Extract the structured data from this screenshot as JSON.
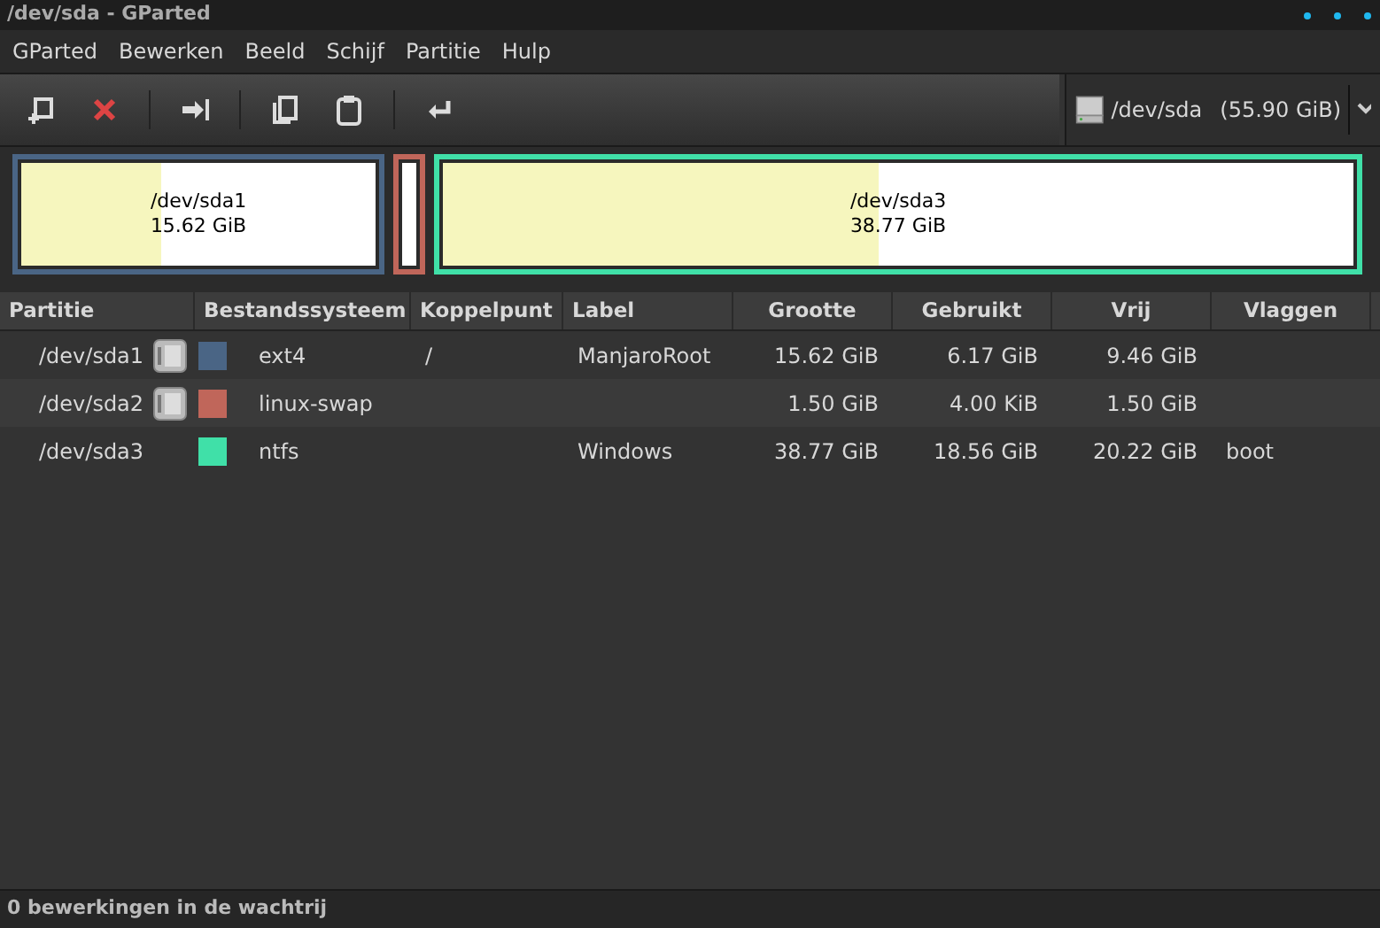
{
  "window": {
    "title": "/dev/sda - GParted"
  },
  "menu": [
    "GParted",
    "Bewerken",
    "Beeld",
    "Schijf",
    "Partitie",
    "Hulp"
  ],
  "toolbar": [
    {
      "kind": "new"
    },
    {
      "kind": "delete"
    },
    {
      "kind": "sep"
    },
    {
      "kind": "resize"
    },
    {
      "kind": "sep"
    },
    {
      "kind": "copy"
    },
    {
      "kind": "paste"
    },
    {
      "kind": "sep"
    },
    {
      "kind": "apply"
    }
  ],
  "device": {
    "name": "/dev/sda",
    "size": "(55.90 GiB)"
  },
  "map": [
    {
      "name": "/dev/sda1",
      "size": "15.62 GiB",
      "color": "#4a6585",
      "level": 0.395
    },
    {
      "color": "#c0665a"
    },
    {
      "name": "/dev/sda3",
      "size": "38.77 GiB",
      "color": "#40e0a8",
      "level": 0.479
    }
  ],
  "table": {
    "columns": [
      "Partitie",
      "Bestandssysteem",
      "Koppelpunt",
      "Label",
      "Grootte",
      "Gebruikt",
      "Vrij",
      "Vlaggen"
    ],
    "rows": [
      {
        "partition": "/dev/sda1",
        "mounted": true,
        "color": "#4a6585",
        "filesystem": "ext4",
        "mountpoint": "/",
        "label": "ManjaroRoot",
        "size": "15.62 GiB",
        "used": "6.17 GiB",
        "free": "9.46 GiB"
      },
      {
        "partition": "/dev/sda2",
        "mounted": true,
        "color": "#c0665a",
        "filesystem": "linux-swap",
        "size": "1.50 GiB",
        "used": "4.00 KiB",
        "free": "1.50 GiB"
      },
      {
        "partition": "/dev/sda3",
        "mounted": false,
        "color": "#40e0a8",
        "filesystem": "ntfs",
        "label": "Windows",
        "size": "38.77 GiB",
        "used": "18.56 GiB",
        "free": "20.22 GiB",
        "flags": "boot"
      }
    ]
  },
  "status_bar": "0 bewerkingen in de wachtrij"
}
